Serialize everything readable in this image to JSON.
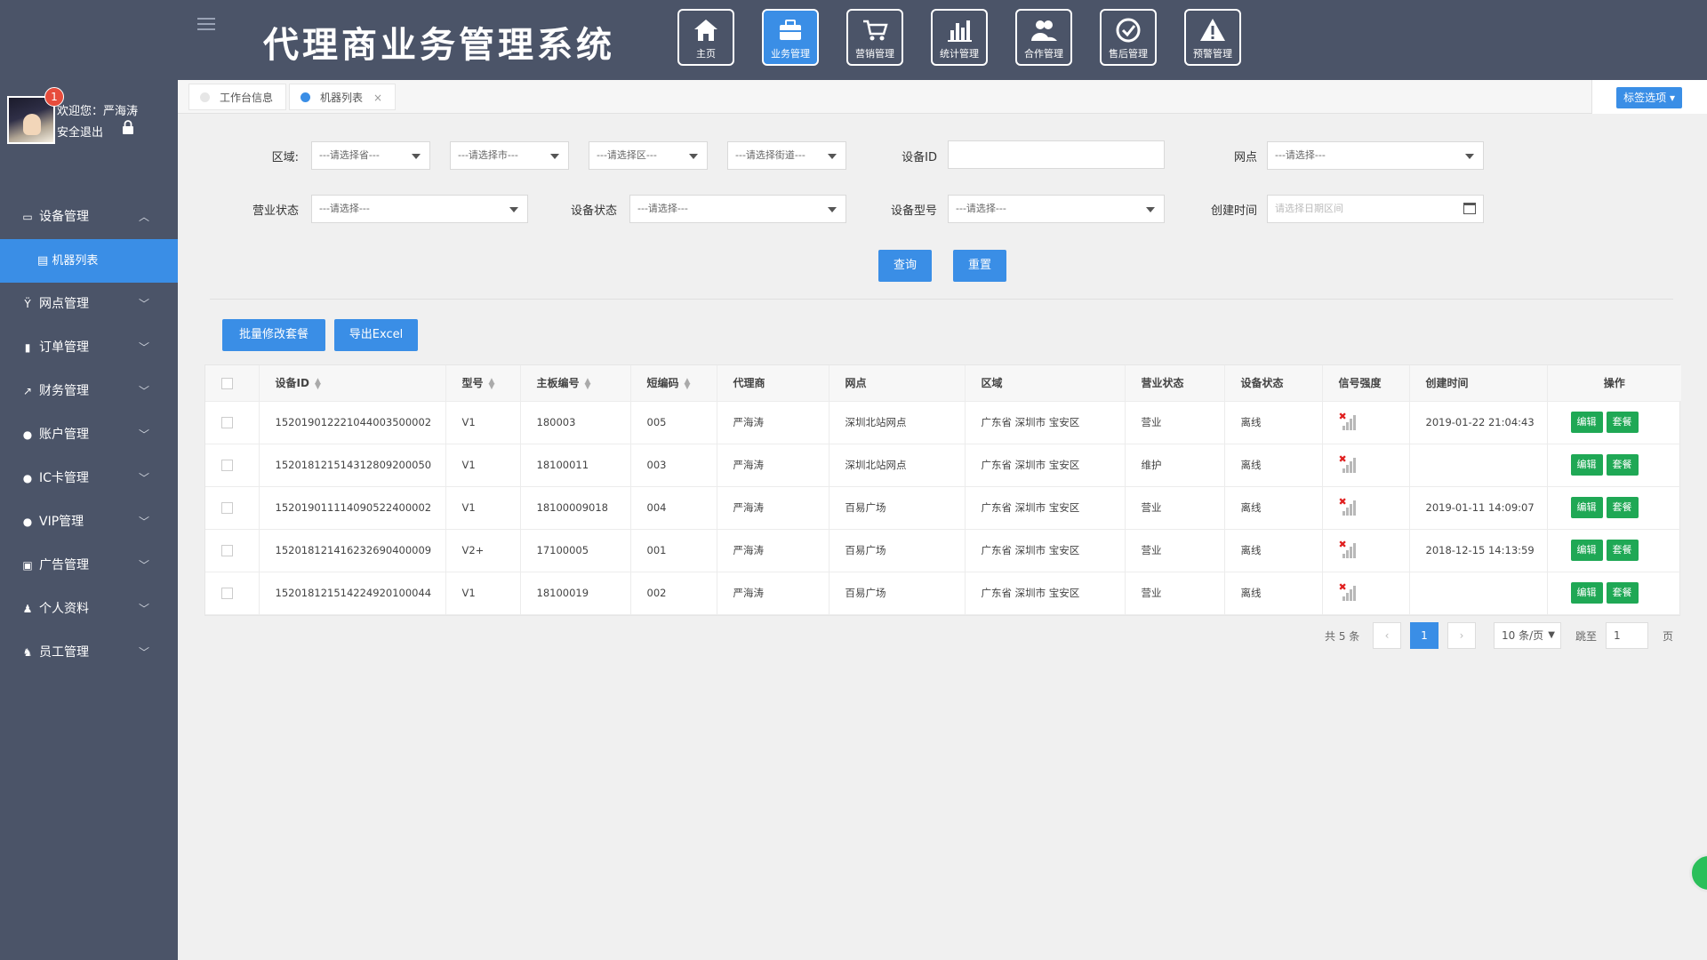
{
  "app": {
    "title": "代理商业务管理系统",
    "nav": [
      {
        "label": "主页",
        "icon": "home-icon",
        "active": false
      },
      {
        "label": "业务管理",
        "icon": "briefcase-icon",
        "active": true
      },
      {
        "label": "营销管理",
        "icon": "cart-icon",
        "active": false
      },
      {
        "label": "统计管理",
        "icon": "bar-chart-icon",
        "active": false
      },
      {
        "label": "合作管理",
        "icon": "users-icon",
        "active": false
      },
      {
        "label": "售后管理",
        "icon": "check-circle-icon",
        "active": false
      },
      {
        "label": "预警管理",
        "icon": "warning-icon",
        "active": false
      }
    ]
  },
  "user": {
    "badge": "1",
    "welcome": "欢迎您：严海涛",
    "logout": "安全退出"
  },
  "sidebar": {
    "items": [
      {
        "label": "设备管理",
        "icon": "monitor-icon",
        "expanded": true
      },
      {
        "label": "网点管理",
        "icon": "branch-icon",
        "expanded": false
      },
      {
        "label": "订单管理",
        "icon": "document-icon",
        "expanded": false
      },
      {
        "label": "财务管理",
        "icon": "trend-icon",
        "expanded": false
      },
      {
        "label": "账户管理",
        "icon": "circle-icon",
        "expanded": false
      },
      {
        "label": "IC卡管理",
        "icon": "circle-icon",
        "expanded": false
      },
      {
        "label": "VIP管理",
        "icon": "circle-icon",
        "expanded": false
      },
      {
        "label": "广告管理",
        "icon": "image-icon",
        "expanded": false
      },
      {
        "label": "个人资料",
        "icon": "person-icon",
        "expanded": false
      },
      {
        "label": "员工管理",
        "icon": "staff-icon",
        "expanded": false
      }
    ],
    "sub_item": "机器列表"
  },
  "tabs": [
    {
      "label": "工作台信息",
      "active": false
    },
    {
      "label": "机器列表",
      "active": true,
      "close": "×"
    }
  ],
  "tag_options": "标签选项",
  "filters": {
    "region_label": "区域:",
    "province": "---请选择省---",
    "city": "---请选择市---",
    "district": "---请选择区---",
    "street": "---请选择街道---",
    "device_id_label": "设备ID",
    "device_id_value": "",
    "outlet_label": "网点",
    "outlet": "---请选择---",
    "biz_status_label": "营业状态",
    "biz_status": "---请选择---",
    "device_status_label": "设备状态",
    "device_status": "---请选择---",
    "device_model_label": "设备型号",
    "device_model": "---请选择---",
    "created_label": "创建时间",
    "created_placeholder": "请选择日期区间",
    "query_btn": "查询",
    "reset_btn": "重置"
  },
  "actions": {
    "batch_edit": "批量修改套餐",
    "export": "导出Excel"
  },
  "table": {
    "columns": [
      "设备ID",
      "型号",
      "主板编号",
      "短编码",
      "代理商",
      "网点",
      "区域",
      "营业状态",
      "设备状态",
      "信号强度",
      "创建时间",
      "操作"
    ],
    "rows": [
      {
        "device_id": "152019012221044003500002",
        "model": "V1",
        "board": "180003",
        "short": "005",
        "agent": "严海涛",
        "outlet": "深圳北站网点",
        "region": "广东省 深圳市 宝安区",
        "biz": "营业",
        "status": "离线",
        "created": "2019-01-22 21:04:43"
      },
      {
        "device_id": "152018121514312809200050",
        "model": "V1",
        "board": "18100011",
        "short": "003",
        "agent": "严海涛",
        "outlet": "深圳北站网点",
        "region": "广东省 深圳市 宝安区",
        "biz": "维护",
        "status": "离线",
        "created": ""
      },
      {
        "device_id": "152019011114090522400002",
        "model": "V1",
        "board": "18100009018",
        "short": "004",
        "agent": "严海涛",
        "outlet": "百易广场",
        "region": "广东省 深圳市 宝安区",
        "biz": "营业",
        "status": "离线",
        "created": "2019-01-11 14:09:07"
      },
      {
        "device_id": "152018121416232690400009",
        "model": "V2+",
        "board": "17100005",
        "short": "001",
        "agent": "严海涛",
        "outlet": "百易广场",
        "region": "广东省 深圳市 宝安区",
        "biz": "营业",
        "status": "离线",
        "created": "2018-12-15 14:13:59"
      },
      {
        "device_id": "152018121514224920100044",
        "model": "V1",
        "board": "18100019",
        "short": "002",
        "agent": "严海涛",
        "outlet": "百易广场",
        "region": "广东省 深圳市 宝安区",
        "biz": "营业",
        "status": "离线",
        "created": ""
      }
    ],
    "edit_label": "编辑",
    "plan_label": "套餐"
  },
  "pagination": {
    "total": "共 5 条",
    "prev": "‹",
    "current": "1",
    "next": "›",
    "page_size": "10 条/页",
    "goto_label": "跳至",
    "goto_value": "1",
    "page_suffix": "页"
  },
  "colors": {
    "header_bg": "#4b5468",
    "accent": "#3a8ee6",
    "op_green": "#1fa855",
    "badge_red": "#e74c3c"
  }
}
